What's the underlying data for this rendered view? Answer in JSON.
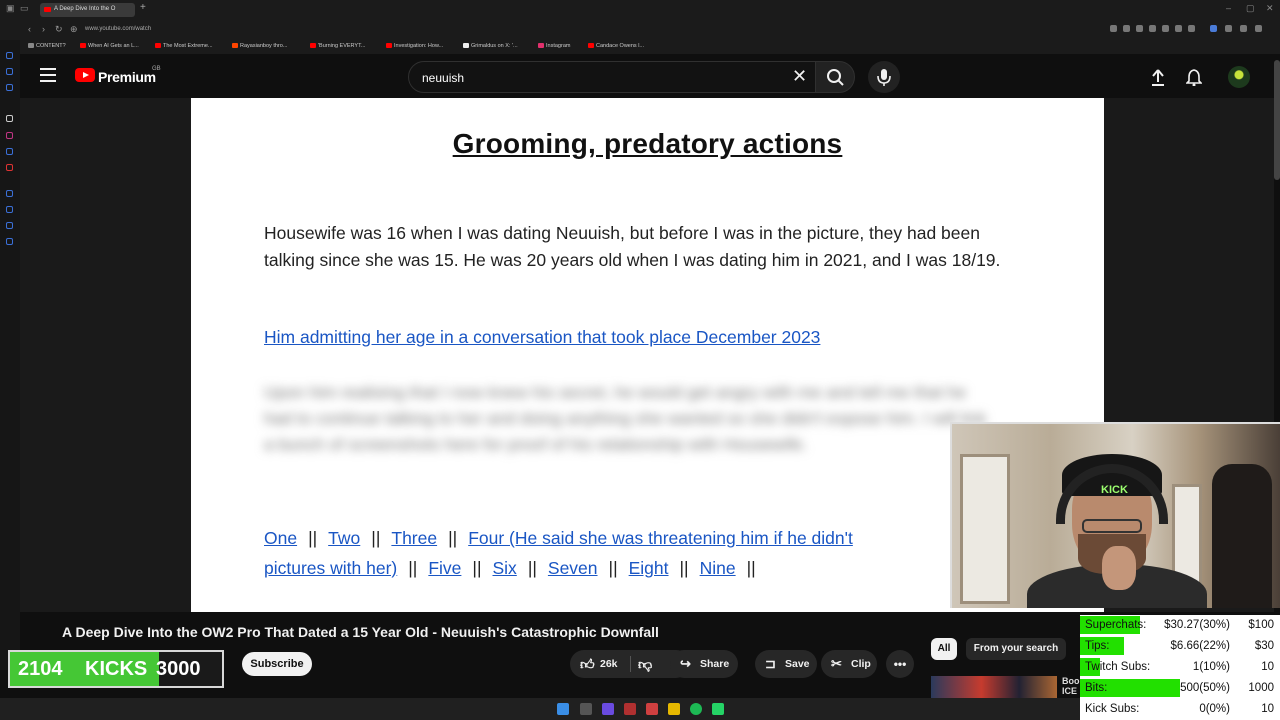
{
  "browser": {
    "active_tab": "A Deep Dive Into the O",
    "url": "www.youtube.com/watch",
    "bookmarks": [
      {
        "label": "CONTENT?",
        "color": "#888888"
      },
      {
        "label": "When AI Gets an L...",
        "color": "#ff0000"
      },
      {
        "label": "The Most Extreme...",
        "color": "#ff0000"
      },
      {
        "label": "Rayasianboy thro...",
        "color": "#ff4500"
      },
      {
        "label": "'Burning EVERYT...",
        "color": "#ff0000"
      },
      {
        "label": "Investigation: How...",
        "color": "#ff0000"
      },
      {
        "label": "Grimaldus on X: '...",
        "color": "#eeeeee"
      },
      {
        "label": "Instagram",
        "color": "#e1306c"
      },
      {
        "label": "Candace Owens l...",
        "color": "#ff0000"
      }
    ]
  },
  "youtube": {
    "brand": "Premium",
    "region": "GB",
    "search_query": "neuuish"
  },
  "document": {
    "title": "Grooming, predatory actions",
    "paragraph": "Housewife was 16 when I was dating Neuuish, but before I was in the picture, they had been talking since she was 15. He was 20 years old when I was dating him in 2021, and I was 18/19.",
    "link": "Him admitting her age in a conversation that took place December 2023",
    "blurred": "Upon him realising that I now knew his secret, he would get angry with me and tell me that he had to continue talking to her and doing anything she wanted so she didn't expose him. I will link a bunch of screenshots here for proof of his relationship with Housewife.",
    "links": {
      "one": "One",
      "two": "Two",
      "three": "Three",
      "four": "Four (He said she was threatening him if he didn't",
      "four_cont": "pictures with her)",
      "five": "Five",
      "six": "Six",
      "seven": "Seven",
      "eight": "Eight",
      "nine": "Nine",
      "sep": "||"
    }
  },
  "webcam": {
    "cap_text": "KICK"
  },
  "video": {
    "title": "A Deep Dive Into the OW2 Pro That Dated a 15 Year Old - Neuuish's Catastrophic Downfall",
    "subscribe": "Subscribe",
    "likes": "26k",
    "share": "Share",
    "save": "Save",
    "clip": "Clip",
    "more": "•••"
  },
  "kicks": {
    "count": "2104",
    "label": "KICKS",
    "goal": "3000",
    "progress": 0.7013
  },
  "recommendations": {
    "chip_all": "All",
    "chip_search": "From your search",
    "rec_title": "Boo",
    "rec_sub": "ICE"
  },
  "donations": [
    {
      "label": "Superchats:",
      "value": "$30.27(30%)",
      "goal": "$100",
      "progress": 0.3
    },
    {
      "label": "Tips:",
      "value": "$6.66(22%)",
      "goal": "$30",
      "progress": 0.22
    },
    {
      "label": "Twitch Subs:",
      "value": "1(10%)",
      "goal": "10",
      "progress": 0.1
    },
    {
      "label": "Bits:",
      "value": "500(50%)",
      "goal": "1000",
      "progress": 0.5
    },
    {
      "label": "Kick Subs:",
      "value": "0(0%)",
      "goal": "10",
      "progress": 0.0
    }
  ]
}
